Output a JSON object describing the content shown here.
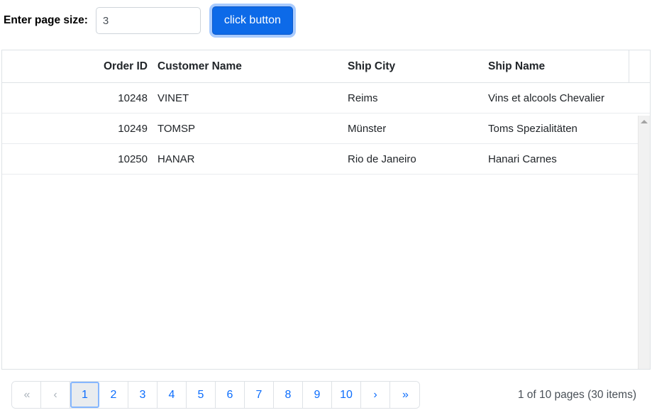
{
  "toolbar": {
    "label": "Enter page size:",
    "input_value": "3",
    "input_placeholder": "",
    "button_label": "click button"
  },
  "grid": {
    "columns": [
      {
        "key": "order_id",
        "label": "Order ID",
        "align": "right"
      },
      {
        "key": "customer_name",
        "label": "Customer Name",
        "align": "left"
      },
      {
        "key": "ship_city",
        "label": "Ship City",
        "align": "left"
      },
      {
        "key": "ship_name",
        "label": "Ship Name",
        "align": "left"
      }
    ],
    "rows": [
      {
        "order_id": "10248",
        "customer_name": "VINET",
        "ship_city": "Reims",
        "ship_name": "Vins et alcools Chevalier"
      },
      {
        "order_id": "10249",
        "customer_name": "TOMSP",
        "ship_city": "Münster",
        "ship_name": "Toms Spezialitäten"
      },
      {
        "order_id": "10250",
        "customer_name": "HANAR",
        "ship_city": "Rio de Janeiro",
        "ship_name": "Hanari Carnes"
      }
    ]
  },
  "scrollbar": {
    "up_arrow": "scroll-up-icon",
    "down_arrow": "scroll-down-icon"
  },
  "pager": {
    "first_label": "«",
    "prev_label": "‹",
    "next_label": "›",
    "last_label": "»",
    "pages": [
      "1",
      "2",
      "3",
      "4",
      "5",
      "6",
      "7",
      "8",
      "9",
      "10"
    ],
    "active_page": "1",
    "status": "1 of 10 pages (30 items)"
  },
  "colors": {
    "accent": "#0d6efd",
    "button_fill": "#0d6ae8",
    "focus_ring": "#86b7fe",
    "border": "#dee2e6",
    "row_divider": "#e9ecef",
    "text": "#212529",
    "muted": "#495057",
    "disabled": "#adb5bd",
    "scroll_track": "#f1f1f1",
    "active_page_fill": "#e9ecef"
  }
}
